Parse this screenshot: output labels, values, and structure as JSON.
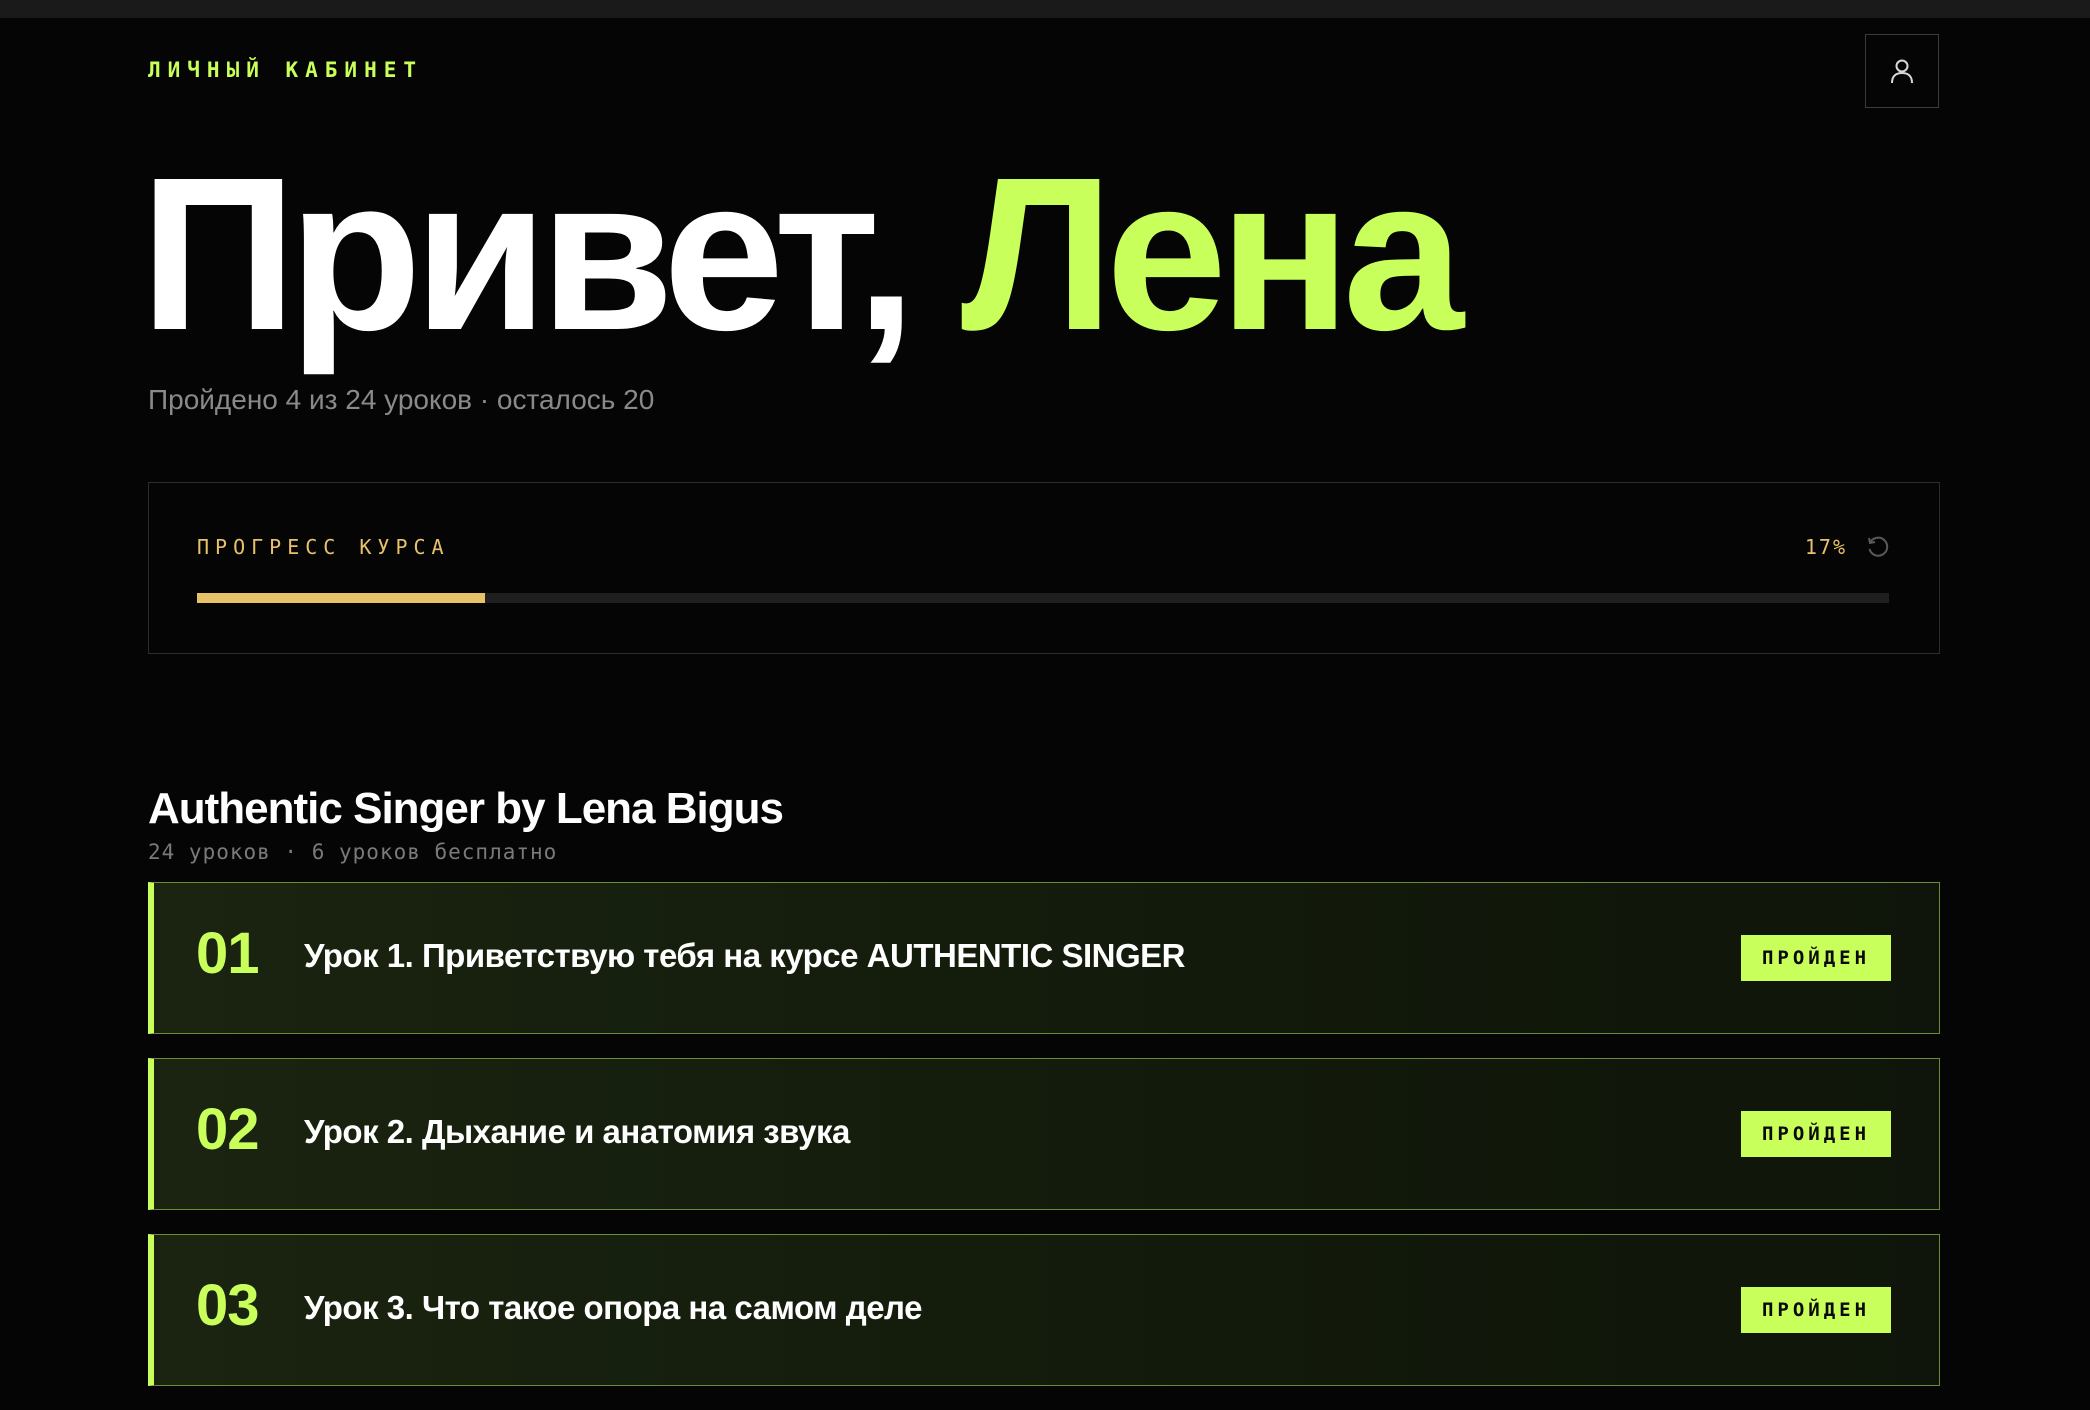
{
  "header": {
    "section_label": "ЛИЧНЫЙ КАБИНЕТ",
    "profile_icon": "user-icon"
  },
  "hero": {
    "greeting": "Привет, ",
    "name": "Лена",
    "subtitle": "Пройдено 4 из 24 уроков · осталось 20"
  },
  "progress": {
    "label": "ПРОГРЕСС КУРСА",
    "percent_text": "17%",
    "value": 0.17,
    "reset_icon": "reset-icon"
  },
  "course": {
    "title": "Authentic Singer by Lena Bigus",
    "meta": "24 уроков · 6 уроков бесплатно"
  },
  "lessons": [
    {
      "number": "01",
      "title": "Урок 1. Приветствую тебя на курсе AUTHENTIC SINGER",
      "status": "ПРОЙДЕН"
    },
    {
      "number": "02",
      "title": "Урок 2. Дыхание и анатомия звука",
      "status": "ПРОЙДЕН"
    },
    {
      "number": "03",
      "title": "Урок 3. Что такое опора на самом деле",
      "status": "ПРОЙДЕН"
    }
  ],
  "colors": {
    "accent": "#c8ff5a",
    "progress": "#e8c268",
    "background": "#050505"
  }
}
